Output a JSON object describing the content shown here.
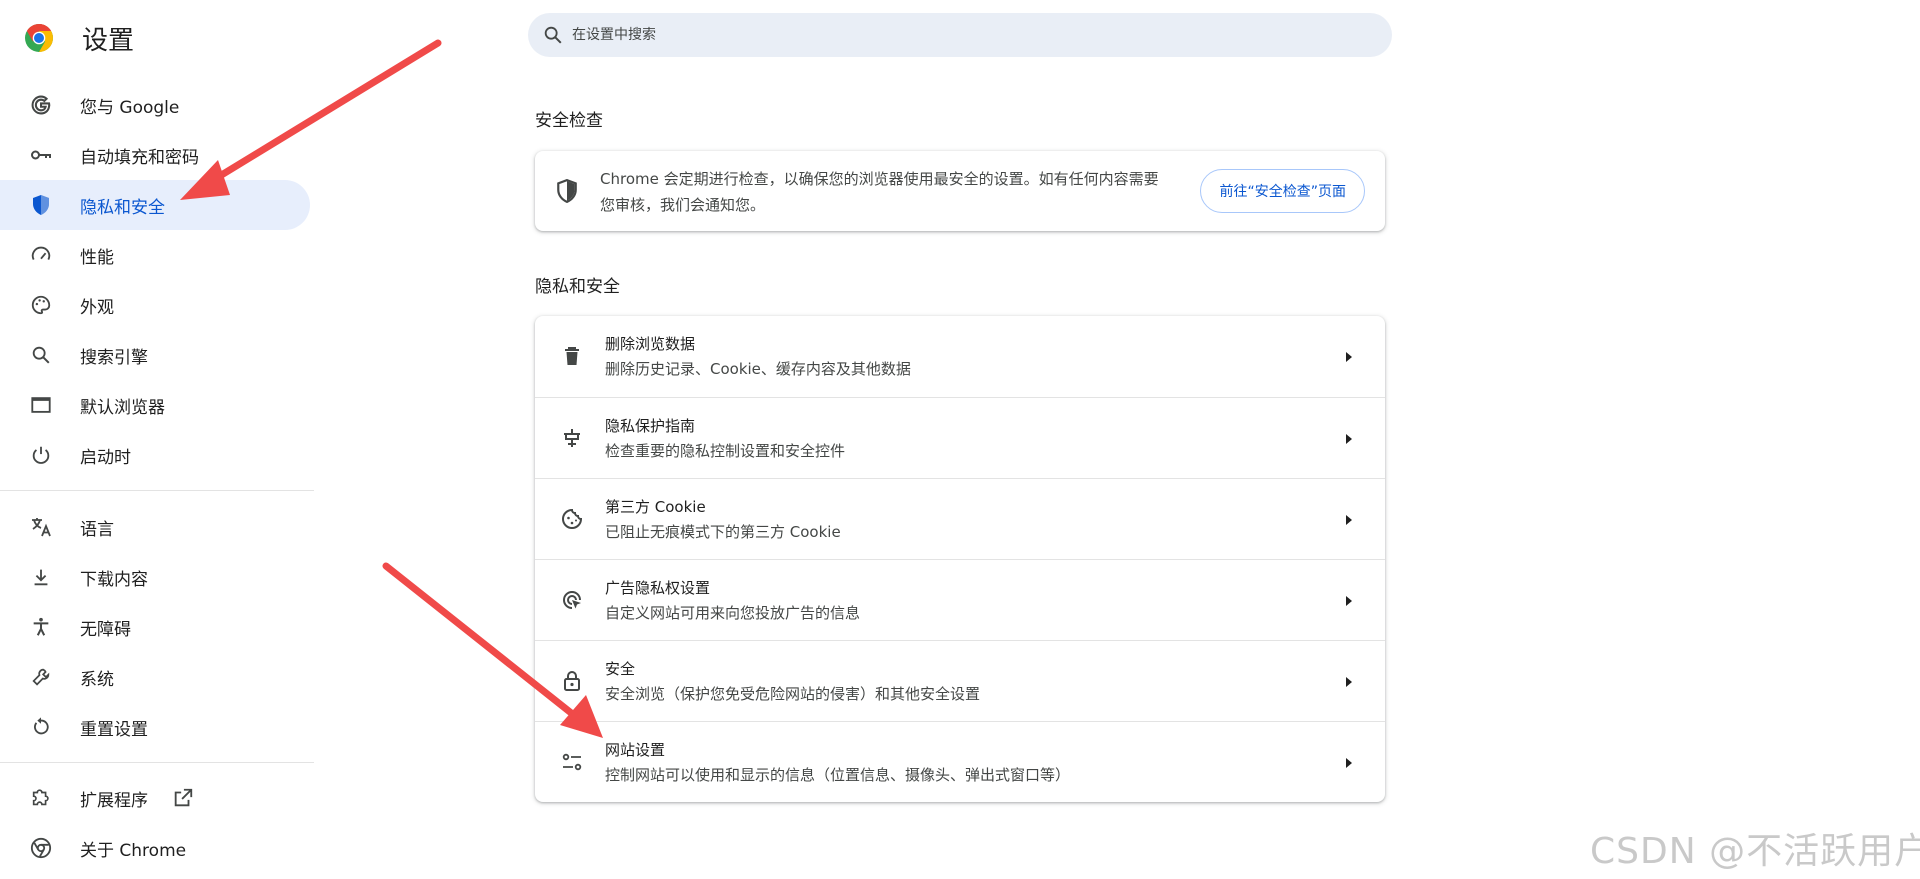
{
  "app": {
    "title": "设置"
  },
  "search": {
    "placeholder": "在设置中搜索"
  },
  "sidebar": {
    "items": [
      {
        "label": "您与 Google",
        "icon": "google-icon"
      },
      {
        "label": "自动填充和密码",
        "icon": "key-icon"
      },
      {
        "label": "隐私和安全",
        "icon": "shield-icon",
        "active": true
      },
      {
        "label": "性能",
        "icon": "speedometer-icon"
      },
      {
        "label": "外观",
        "icon": "palette-icon"
      },
      {
        "label": "搜索引擎",
        "icon": "search-icon"
      },
      {
        "label": "默认浏览器",
        "icon": "browser-window-icon"
      },
      {
        "label": "启动时",
        "icon": "power-icon"
      },
      {
        "label": "语言",
        "icon": "translate-icon"
      },
      {
        "label": "下载内容",
        "icon": "download-icon"
      },
      {
        "label": "无障碍",
        "icon": "accessibility-icon"
      },
      {
        "label": "系统",
        "icon": "wrench-icon"
      },
      {
        "label": "重置设置",
        "icon": "reset-icon"
      },
      {
        "label": "扩展程序",
        "icon": "puzzle-icon"
      },
      {
        "label": "关于 Chrome",
        "icon": "chrome-icon"
      }
    ]
  },
  "safety_check": {
    "title": "安全检查",
    "description": "Chrome 会定期进行检查，以确保您的浏览器使用最安全的设置。如有任何内容需要您审核，我们会通知您。",
    "button": "前往“安全检查”页面"
  },
  "privacy": {
    "title": "隐私和安全",
    "rows": [
      {
        "title": "删除浏览数据",
        "subtitle": "删除历史记录、Cookie、缓存内容及其他数据",
        "icon": "trash-icon"
      },
      {
        "title": "隐私保护指南",
        "subtitle": "检查重要的隐私控制设置和安全控件",
        "icon": "privacy-guide-icon"
      },
      {
        "title": "第三方 Cookie",
        "subtitle": "已阻止无痕模式下的第三方 Cookie",
        "icon": "cookie-icon"
      },
      {
        "title": "广告隐私权设置",
        "subtitle": "自定义网站可用来向您投放广告的信息",
        "icon": "ad-privacy-icon"
      },
      {
        "title": "安全",
        "subtitle": "安全浏览（保护您免受危险网站的侵害）和其他安全设置",
        "icon": "lock-icon"
      },
      {
        "title": "网站设置",
        "subtitle": "控制网站可以使用和显示的信息（位置信息、摄像头、弹出式窗口等）",
        "icon": "site-settings-icon"
      }
    ]
  },
  "watermark": "CSDN @不活跃用户",
  "colors": {
    "accent": "#0b57d0",
    "active_bg": "#e7eefc",
    "search_bg": "#e9eef6",
    "arrow": "#f04a49"
  }
}
